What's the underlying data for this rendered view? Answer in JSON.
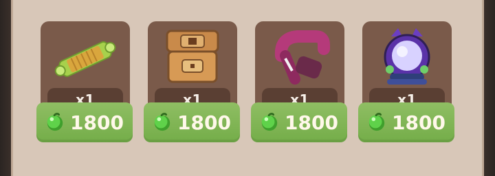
{
  "shop": {
    "items": [
      {
        "name": "Green scroll",
        "qty_label": "x1",
        "price": "1800",
        "icon": "scroll-icon"
      },
      {
        "name": "Wooden chest",
        "qty_label": "x1",
        "price": "1800",
        "icon": "chest-icon"
      },
      {
        "name": "Pink clamp",
        "qty_label": "x1",
        "price": "1800",
        "icon": "clamp-icon"
      },
      {
        "name": "Purple orb lantern",
        "qty_label": "x1",
        "price": "1800",
        "icon": "orb-lantern-icon"
      }
    ],
    "currency_icon": "green-coin-icon",
    "colors": {
      "panel": "#d8c7b8",
      "card": "#7a5a4a",
      "qty_plate": "#5a3f33",
      "button": "#7fb653",
      "coin": "#4fbf3a"
    }
  }
}
